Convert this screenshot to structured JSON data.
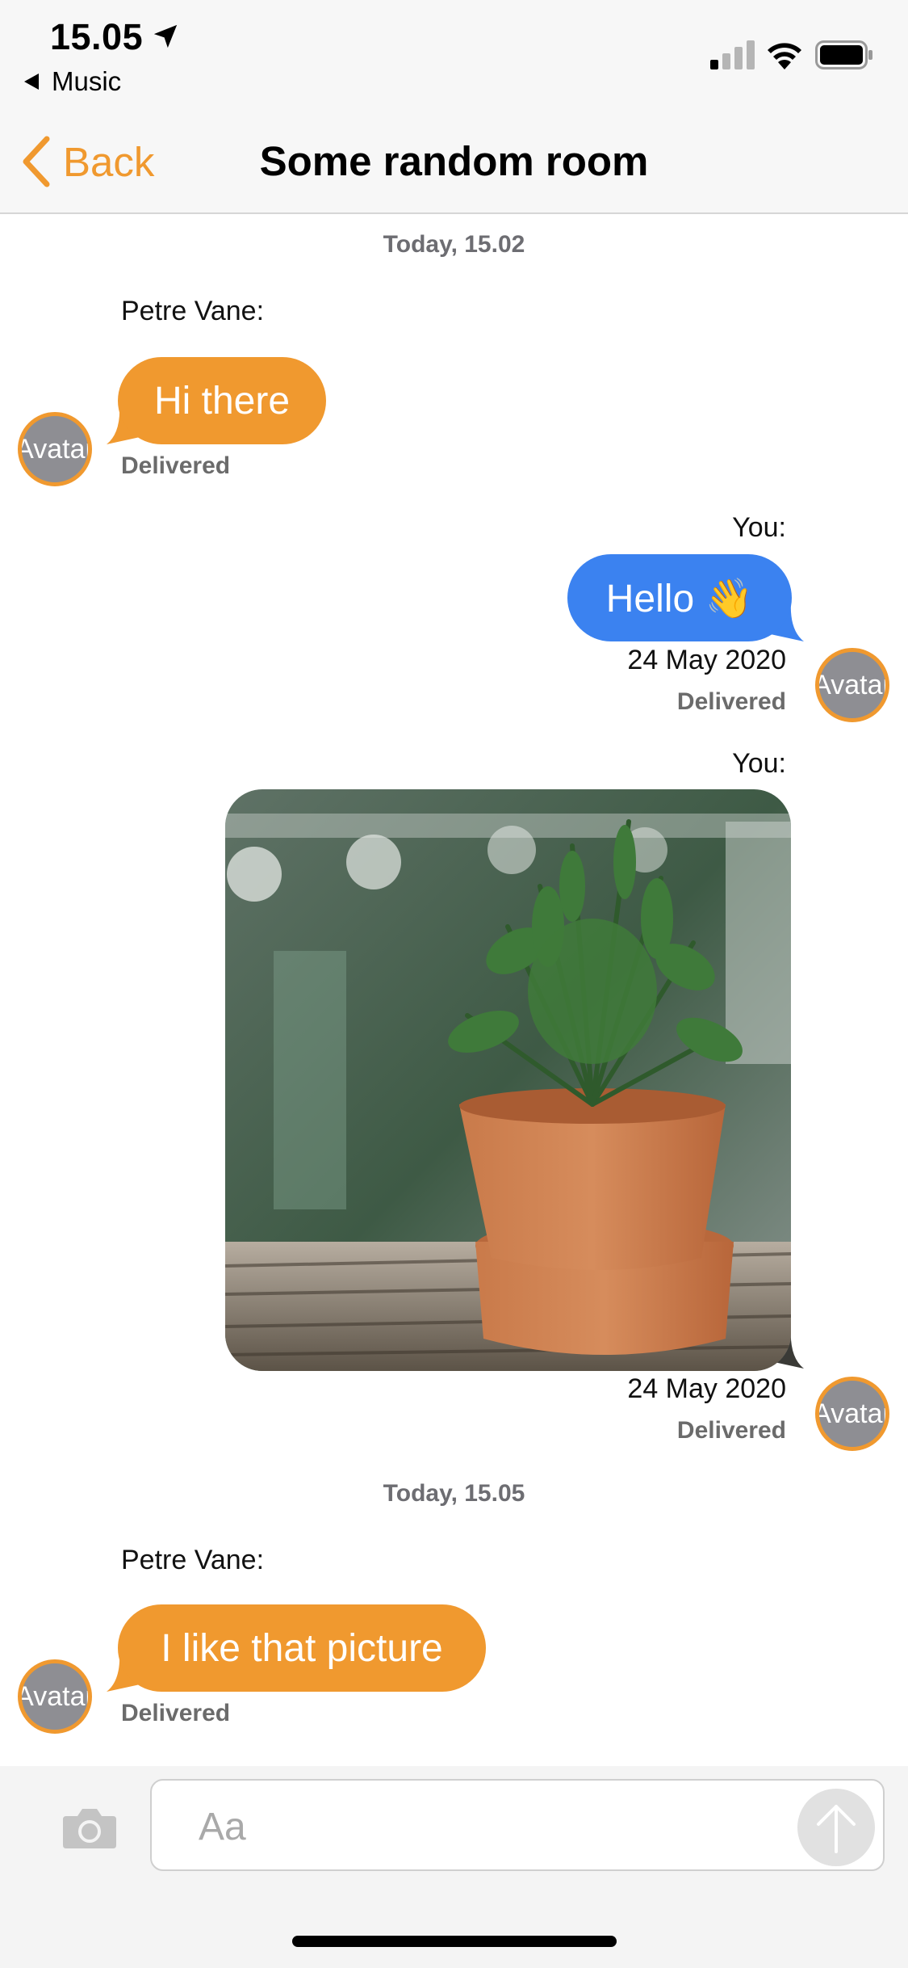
{
  "status_bar": {
    "time": "15.05",
    "back_app": "Music",
    "icons": [
      "location-arrow-icon",
      "signal-icon",
      "wifi-icon",
      "battery-icon"
    ]
  },
  "nav": {
    "back_label": "Back",
    "title": "Some random room"
  },
  "messages": {
    "ts1": "Today, 15.02",
    "m1": {
      "sender": "Petre Vane:",
      "text": "Hi there",
      "status": "Delivered",
      "avatar": "Avatar"
    },
    "m2": {
      "sender": "You:",
      "text": "Hello 👋",
      "date": "24 May 2020",
      "status": "Delivered",
      "avatar": "Avatar"
    },
    "m3": {
      "sender": "You:",
      "date": "24 May 2020",
      "status": "Delivered",
      "avatar": "Avatar"
    },
    "ts2": "Today, 15.05",
    "m4": {
      "sender": "Petre Vane:",
      "text": "I like that picture",
      "status": "Delivered",
      "avatar": "Avatar"
    }
  },
  "composer": {
    "placeholder": "Aa",
    "value": ""
  },
  "colors": {
    "accent": "#f0992f",
    "outgoing_bubble": "#3b82f0",
    "incoming_bubble": "#f0992f",
    "avatar_fill": "#8e8e93"
  }
}
